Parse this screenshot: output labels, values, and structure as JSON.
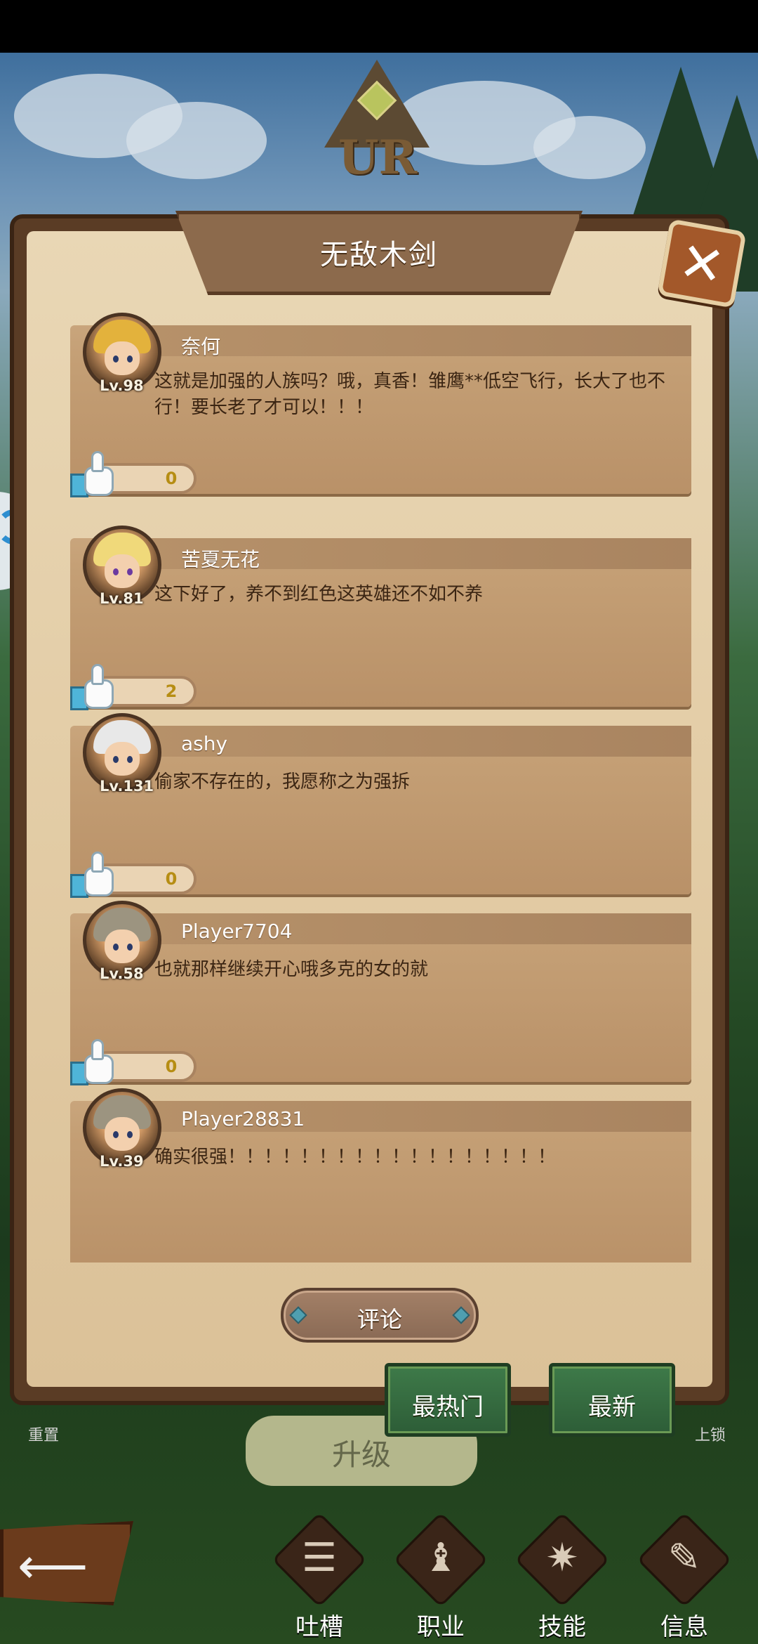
{
  "emblem": {
    "rarity": "UR"
  },
  "dialog": {
    "title": "无敌木剑",
    "close_label": "✕",
    "comments": [
      {
        "username": "奈何",
        "level": "Lv.98",
        "content": "这就是加强的人族吗？哦，真香！雏鹰**低空飞行，长大了也不行！要长老了才可以！！！",
        "likes": "0"
      },
      {
        "username": "苦夏无花",
        "level": "Lv.81",
        "content": "这下好了，养不到红色这英雄还不如不养",
        "likes": "2"
      },
      {
        "username": "ashy",
        "level": "Lv.131",
        "content": "偷家不存在的，我愿称之为强拆",
        "likes": "0"
      },
      {
        "username": "Player7704",
        "level": "Lv.58",
        "content": "也就那样继续开心哦多克的女的就",
        "likes": "0"
      },
      {
        "username": "Player28831",
        "level": "Lv.39",
        "content": "确实很强！！！！！！！！！！！！！！！！！！",
        "likes": ""
      }
    ],
    "comment_button": "评论"
  },
  "sort_tabs": {
    "hottest": "最热门",
    "newest": "最新"
  },
  "background_ui": {
    "upgrade": "升级",
    "reset": "重置",
    "lock": "上锁"
  },
  "bottom_nav": {
    "back_glyph": "⟵",
    "items": [
      {
        "label": "吐槽",
        "glyph": "☰",
        "icon": "scroll-icon"
      },
      {
        "label": "职业",
        "glyph": "♝",
        "icon": "chess-piece-icon"
      },
      {
        "label": "技能",
        "glyph": "✷",
        "icon": "skill-icon"
      },
      {
        "label": "信息",
        "glyph": "✎",
        "icon": "document-icon"
      }
    ]
  },
  "colors": {
    "parchment": "#e2cba4",
    "frame": "#5a3c25",
    "tab_green": "#3e7a49",
    "like_gold": "#b68d13"
  }
}
